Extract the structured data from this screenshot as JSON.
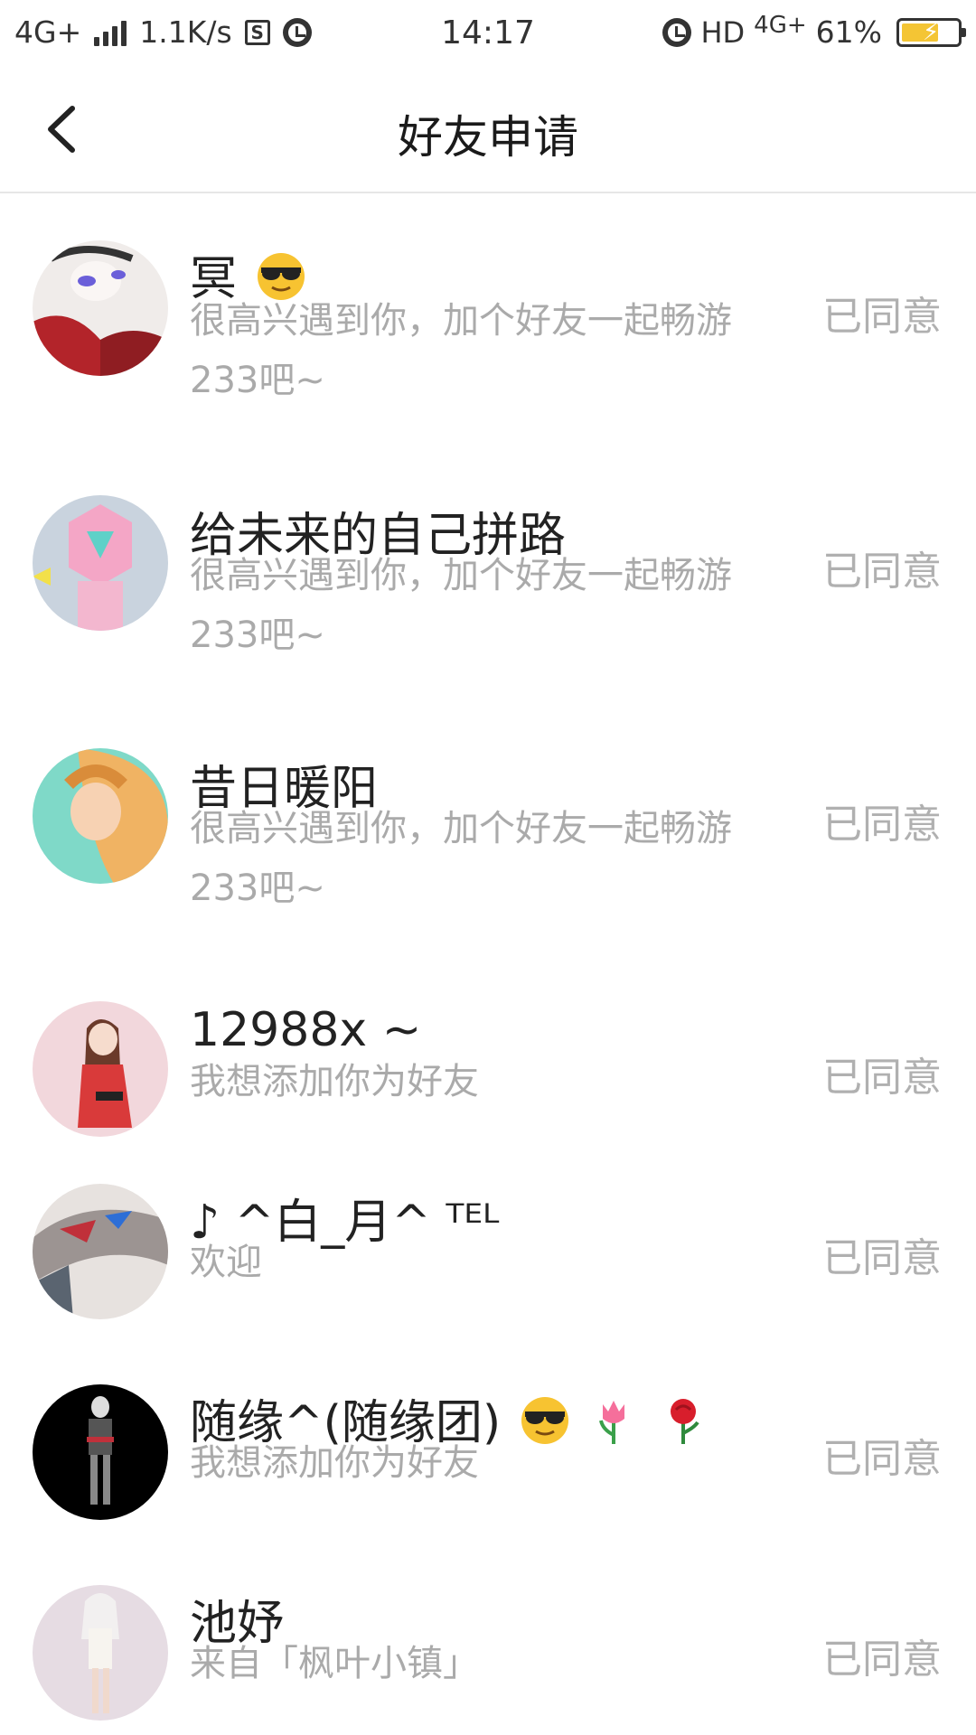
{
  "status_bar": {
    "network": "4G+",
    "speed": "1.1K/s",
    "sim_icon": "S",
    "time": "14:17",
    "hd": "HD",
    "network_right": "4G+",
    "battery_percent": "61%",
    "battery_level": 0.61
  },
  "header": {
    "title": "好友申请"
  },
  "requests": [
    {
      "name": "冥",
      "name_emojis": [
        "sunglasses-emoji"
      ],
      "message": "很高兴遇到你，加个好友一起畅游233吧~",
      "status": "已同意"
    },
    {
      "name": "给未来的自己拼路",
      "name_emojis": [],
      "message": "很高兴遇到你，加个好友一起畅游233吧~",
      "status": "已同意"
    },
    {
      "name": "昔日暖阳",
      "name_emojis": [],
      "message": "很高兴遇到你，加个好友一起畅游233吧~",
      "status": "已同意"
    },
    {
      "name": "12988x ~",
      "name_emojis": [],
      "message": "我想添加你为好友",
      "status": "已同意"
    },
    {
      "name": "♪ ^白_月^ ᵀᴱᴸ",
      "name_emojis": [],
      "message": "欢迎",
      "status": "已同意"
    },
    {
      "name": "随缘^(随缘团)",
      "name_emojis": [
        "sunglasses-emoji",
        "tulip-emoji",
        "rose-emoji"
      ],
      "message": "我想添加你为好友",
      "status": "已同意"
    },
    {
      "name": "池妤",
      "name_emojis": [],
      "message": "来自「枫叶小镇」",
      "status": "已同意"
    }
  ],
  "colors": {
    "status_text": "#b0b0b0",
    "message_text": "#aaaaaa",
    "title_text": "#1a1a1a"
  }
}
